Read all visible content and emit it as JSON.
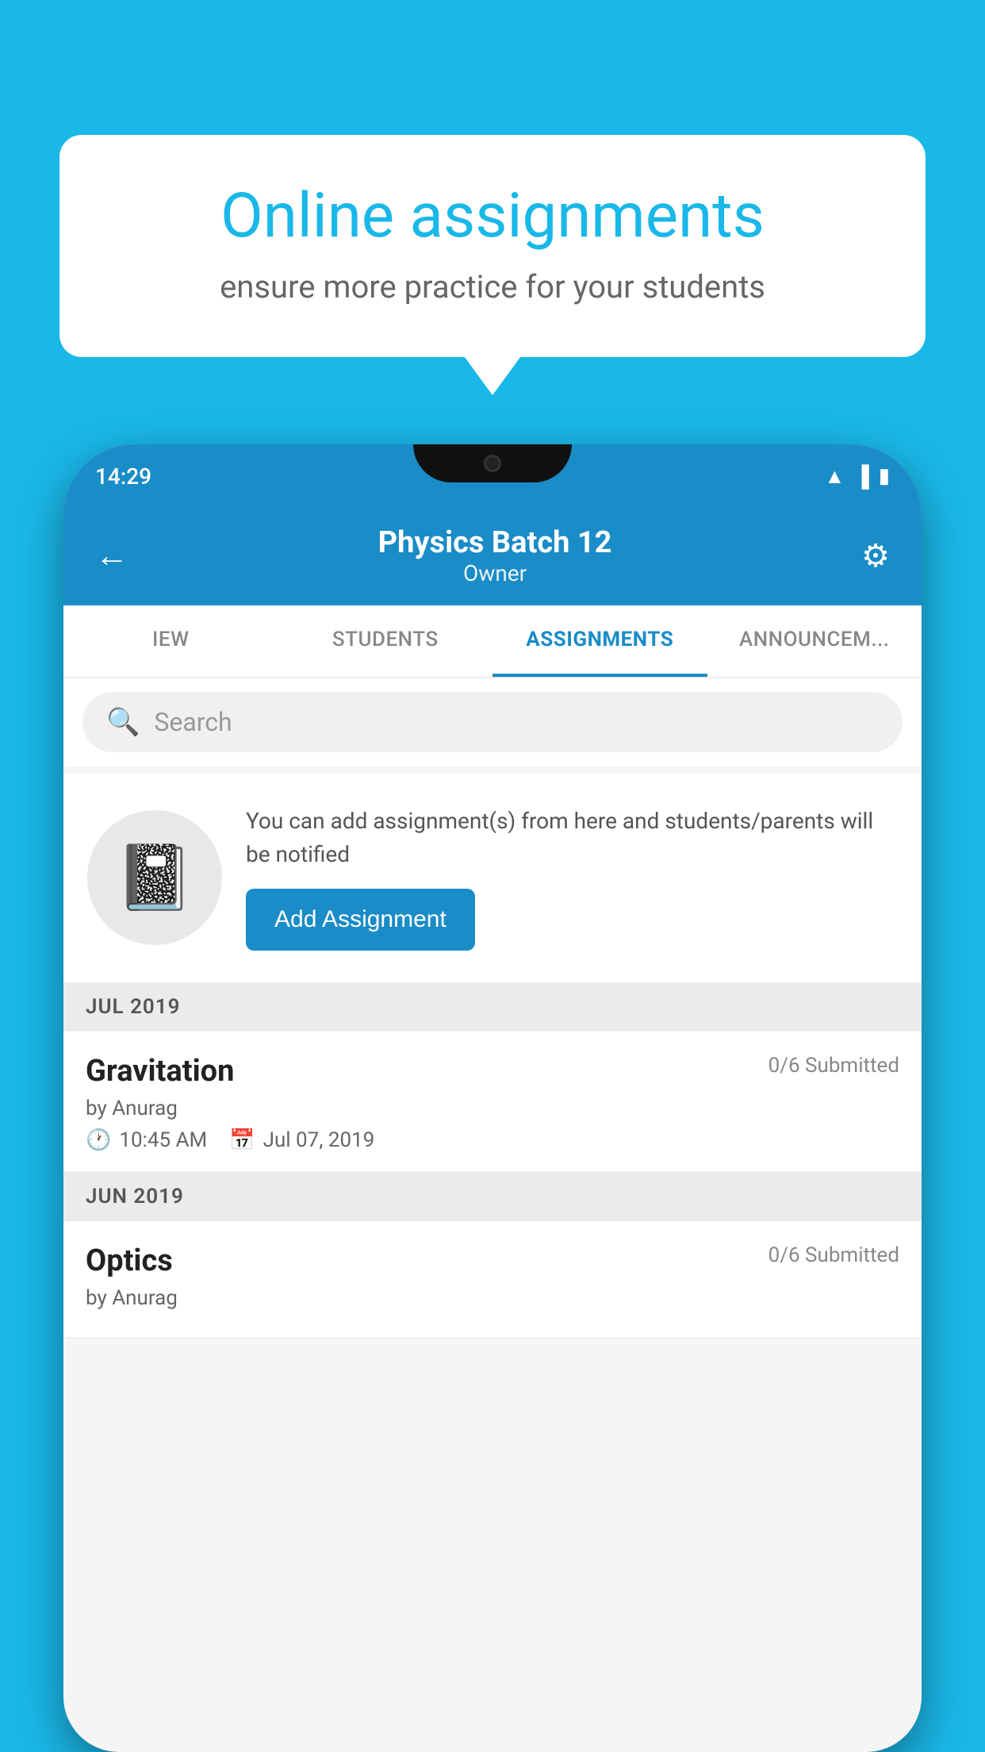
{
  "background_color": "#1ab8e8",
  "speech_bubble": {
    "title": "Online assignments",
    "subtitle": "ensure more practice for your students"
  },
  "phone": {
    "status_bar": {
      "time": "14:29",
      "icons": [
        "wifi",
        "signal",
        "battery"
      ]
    },
    "header": {
      "title": "Physics Batch 12",
      "subtitle": "Owner",
      "back_label": "←",
      "gear_label": "⚙"
    },
    "tabs": [
      {
        "label": "IEW",
        "active": false
      },
      {
        "label": "STUDENTS",
        "active": false
      },
      {
        "label": "ASSIGNMENTS",
        "active": true
      },
      {
        "label": "ANNOUNCEM...",
        "active": false
      }
    ],
    "search": {
      "placeholder": "Search"
    },
    "promo": {
      "description": "You can add assignment(s) from here and students/parents will be notified",
      "button_label": "Add Assignment"
    },
    "sections": [
      {
        "month_label": "JUL 2019",
        "assignments": [
          {
            "title": "Gravitation",
            "submitted": "0/6 Submitted",
            "by": "by Anurag",
            "time": "10:45 AM",
            "date": "Jul 07, 2019"
          }
        ]
      },
      {
        "month_label": "JUN 2019",
        "assignments": [
          {
            "title": "Optics",
            "submitted": "0/6 Submitted",
            "by": "by Anurag",
            "time": "",
            "date": ""
          }
        ]
      }
    ]
  }
}
